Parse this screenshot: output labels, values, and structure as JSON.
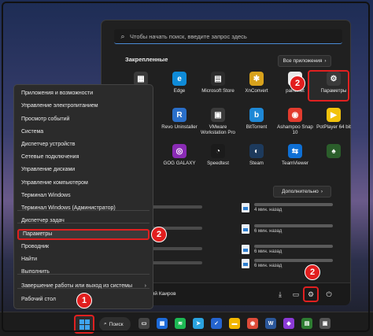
{
  "start_menu": {
    "search_placeholder": "Чтобы начать поиск, введите запрос здесь",
    "pinned_title": "Закрепленные",
    "all_apps_label": "Все приложения",
    "apps": [
      {
        "label": "",
        "icon": "calculator-icon",
        "color": "#3a3a3a",
        "glyph": "▦"
      },
      {
        "label": "Edge",
        "icon": "edge-icon",
        "color": "#0f8bd8",
        "glyph": "e"
      },
      {
        "label": "Microsoft Store",
        "icon": "store-icon",
        "color": "#2c2c2c",
        "glyph": "▤"
      },
      {
        "label": "XnConvert",
        "icon": "xnconvert-icon",
        "color": "#d8a21c",
        "glyph": "✱"
      },
      {
        "label": "paint.net",
        "icon": "paintnet-icon",
        "color": "#e8e8e8",
        "glyph": "🖌"
      },
      {
        "label": "Параметры",
        "icon": "settings-gear-icon",
        "color": "#3b3b3b",
        "glyph": "⚙"
      },
      {
        "label": "",
        "icon": "app-icon",
        "color": "#c0392b",
        "glyph": "◆"
      },
      {
        "label": "Revo Uninstaller",
        "icon": "revo-icon",
        "color": "#2a6fc9",
        "glyph": "R"
      },
      {
        "label": "VMware Workstation Pro",
        "icon": "vmware-icon",
        "color": "#3b3b3b",
        "glyph": "▣"
      },
      {
        "label": "BitTorrent",
        "icon": "bittorrent-icon",
        "color": "#1e88d6",
        "glyph": "b"
      },
      {
        "label": "Ashampoo Snap 10",
        "icon": "ashampoo-icon",
        "color": "#e23b2e",
        "glyph": "◉"
      },
      {
        "label": "PotPlayer 64 bit",
        "icon": "potplayer-icon",
        "color": "#f2c20c",
        "glyph": "▶"
      },
      {
        "label": "",
        "icon": "app-icon",
        "color": "#c94b1a",
        "glyph": "◆"
      },
      {
        "label": "GOG GALAXY",
        "icon": "gog-icon",
        "color": "#8a2bb5",
        "glyph": "◎"
      },
      {
        "label": "Speedtest",
        "icon": "speedtest-icon",
        "color": "#1b1b1b",
        "glyph": "◔"
      },
      {
        "label": "Steam",
        "icon": "steam-icon",
        "color": "#1d3a5c",
        "glyph": "◐"
      },
      {
        "label": "TeamViewer",
        "icon": "teamviewer-icon",
        "color": "#0e6fd4",
        "glyph": "⇆"
      },
      {
        "label": "",
        "icon": "solitaire-icon",
        "color": "#2b5e2b",
        "glyph": "♠"
      }
    ],
    "recommended_title": "ем",
    "more_label": "Дополнительно",
    "recent": [
      {
        "time": "4 мин. назад"
      },
      {
        "time": "6 мин. назад"
      },
      {
        "time": "6 мин. назад"
      },
      {
        "time": "6 мин. назад"
      }
    ],
    "user_name": "лий Каиров"
  },
  "context_menu": {
    "items": [
      {
        "label": "Приложения и возможности"
      },
      {
        "label": "Управление электропитанием"
      },
      {
        "label": "Просмотр событий"
      },
      {
        "label": "Система"
      },
      {
        "label": "Диспетчер устройств"
      },
      {
        "label": "Сетевые подключения"
      },
      {
        "label": "Управление дисками"
      },
      {
        "label": "Управление компьютером"
      },
      {
        "label": "Терминал Windows"
      },
      {
        "label": "Терминал Windows (Администратор)"
      },
      {
        "label": "Диспетчер задач"
      },
      {
        "label": "Параметры"
      },
      {
        "label": "Проводник"
      },
      {
        "label": "Найти"
      },
      {
        "label": "Выполнить"
      },
      {
        "label": "Завершение работы или выход из системы"
      },
      {
        "label": "Рабочий стол"
      }
    ]
  },
  "badges": {
    "step1": "1",
    "step2": "2"
  },
  "taskbar": {
    "search_label": "Поиск",
    "apps": [
      {
        "icon": "task-view-icon",
        "color": "#444",
        "glyph": "▭"
      },
      {
        "icon": "widgets-icon",
        "color": "#1d6ad8",
        "glyph": "▦"
      },
      {
        "icon": "spotify-icon",
        "color": "#1db954",
        "glyph": "≋"
      },
      {
        "icon": "telegram-icon",
        "color": "#2aa3e0",
        "glyph": "➤"
      },
      {
        "icon": "todo-icon",
        "color": "#2564cf",
        "glyph": "✓"
      },
      {
        "icon": "explorer-icon",
        "color": "#f2b600",
        "glyph": "▬"
      },
      {
        "icon": "chrome-icon",
        "color": "#dd4b39",
        "glyph": "◉"
      },
      {
        "icon": "word-icon",
        "color": "#2b579a",
        "glyph": "W"
      },
      {
        "icon": "app-icon",
        "color": "#8b3ad6",
        "glyph": "◆"
      },
      {
        "icon": "app-icon",
        "color": "#2e7d32",
        "glyph": "▤"
      },
      {
        "icon": "app-icon",
        "color": "#555",
        "glyph": "▣"
      }
    ]
  }
}
